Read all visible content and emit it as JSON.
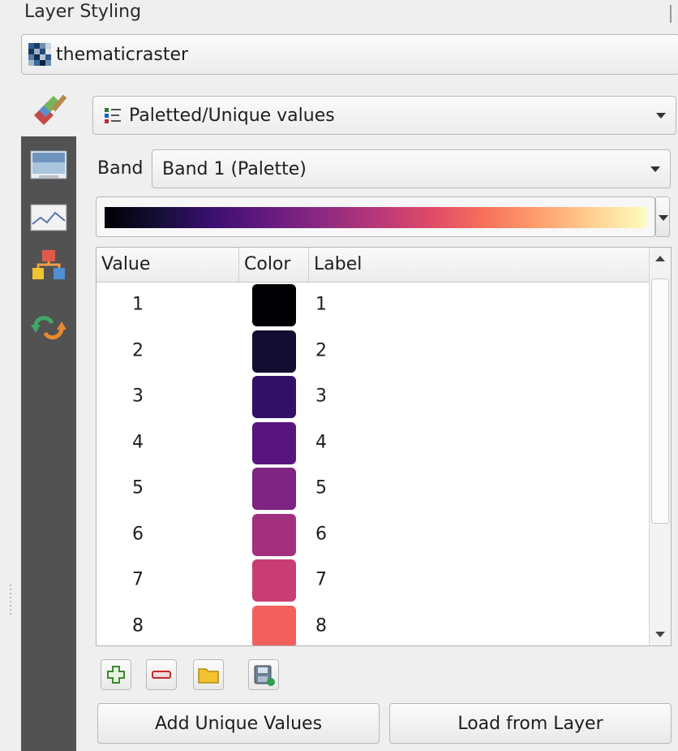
{
  "panel": {
    "title": "Layer Styling"
  },
  "layer": {
    "name": "thematicraster",
    "icon": "raster-layer-icon"
  },
  "renderer": {
    "label": "Paletted/Unique values",
    "icon": "paletted-renderer-icon"
  },
  "band": {
    "label": "Band",
    "value": "Band 1 (Palette)"
  },
  "color_ramp": {
    "name": "magma",
    "colors": [
      "#000004",
      "#150e37",
      "#3b0f70",
      "#641a80",
      "#8c2981",
      "#b73779",
      "#de4968",
      "#f7705c",
      "#fe9f6d",
      "#fecf92",
      "#fcfdbf"
    ]
  },
  "table": {
    "headers": [
      "Value",
      "Color",
      "Label"
    ],
    "rows": [
      {
        "value": "1",
        "color": "#000004",
        "label": "1"
      },
      {
        "value": "2",
        "color": "#120d31",
        "label": "2"
      },
      {
        "value": "3",
        "color": "#331067",
        "label": "3"
      },
      {
        "value": "4",
        "color": "#59157e",
        "label": "4"
      },
      {
        "value": "5",
        "color": "#7e2482",
        "label": "5"
      },
      {
        "value": "6",
        "color": "#a3307e",
        "label": "6"
      },
      {
        "value": "7",
        "color": "#c83e73",
        "label": "7"
      },
      {
        "value": "8",
        "color": "#f1605d",
        "label": "8"
      }
    ]
  },
  "toolbar": {
    "icons": [
      "add-icon",
      "remove-icon",
      "load-file-icon",
      "save-icon"
    ]
  },
  "buttons": {
    "add_unique": "Add Unique Values",
    "load_from_layer": "Load from Layer"
  },
  "side_tabs": [
    "symbology-icon",
    "transparency-icon",
    "histogram-icon",
    "rendering-icon",
    "history-icon"
  ]
}
